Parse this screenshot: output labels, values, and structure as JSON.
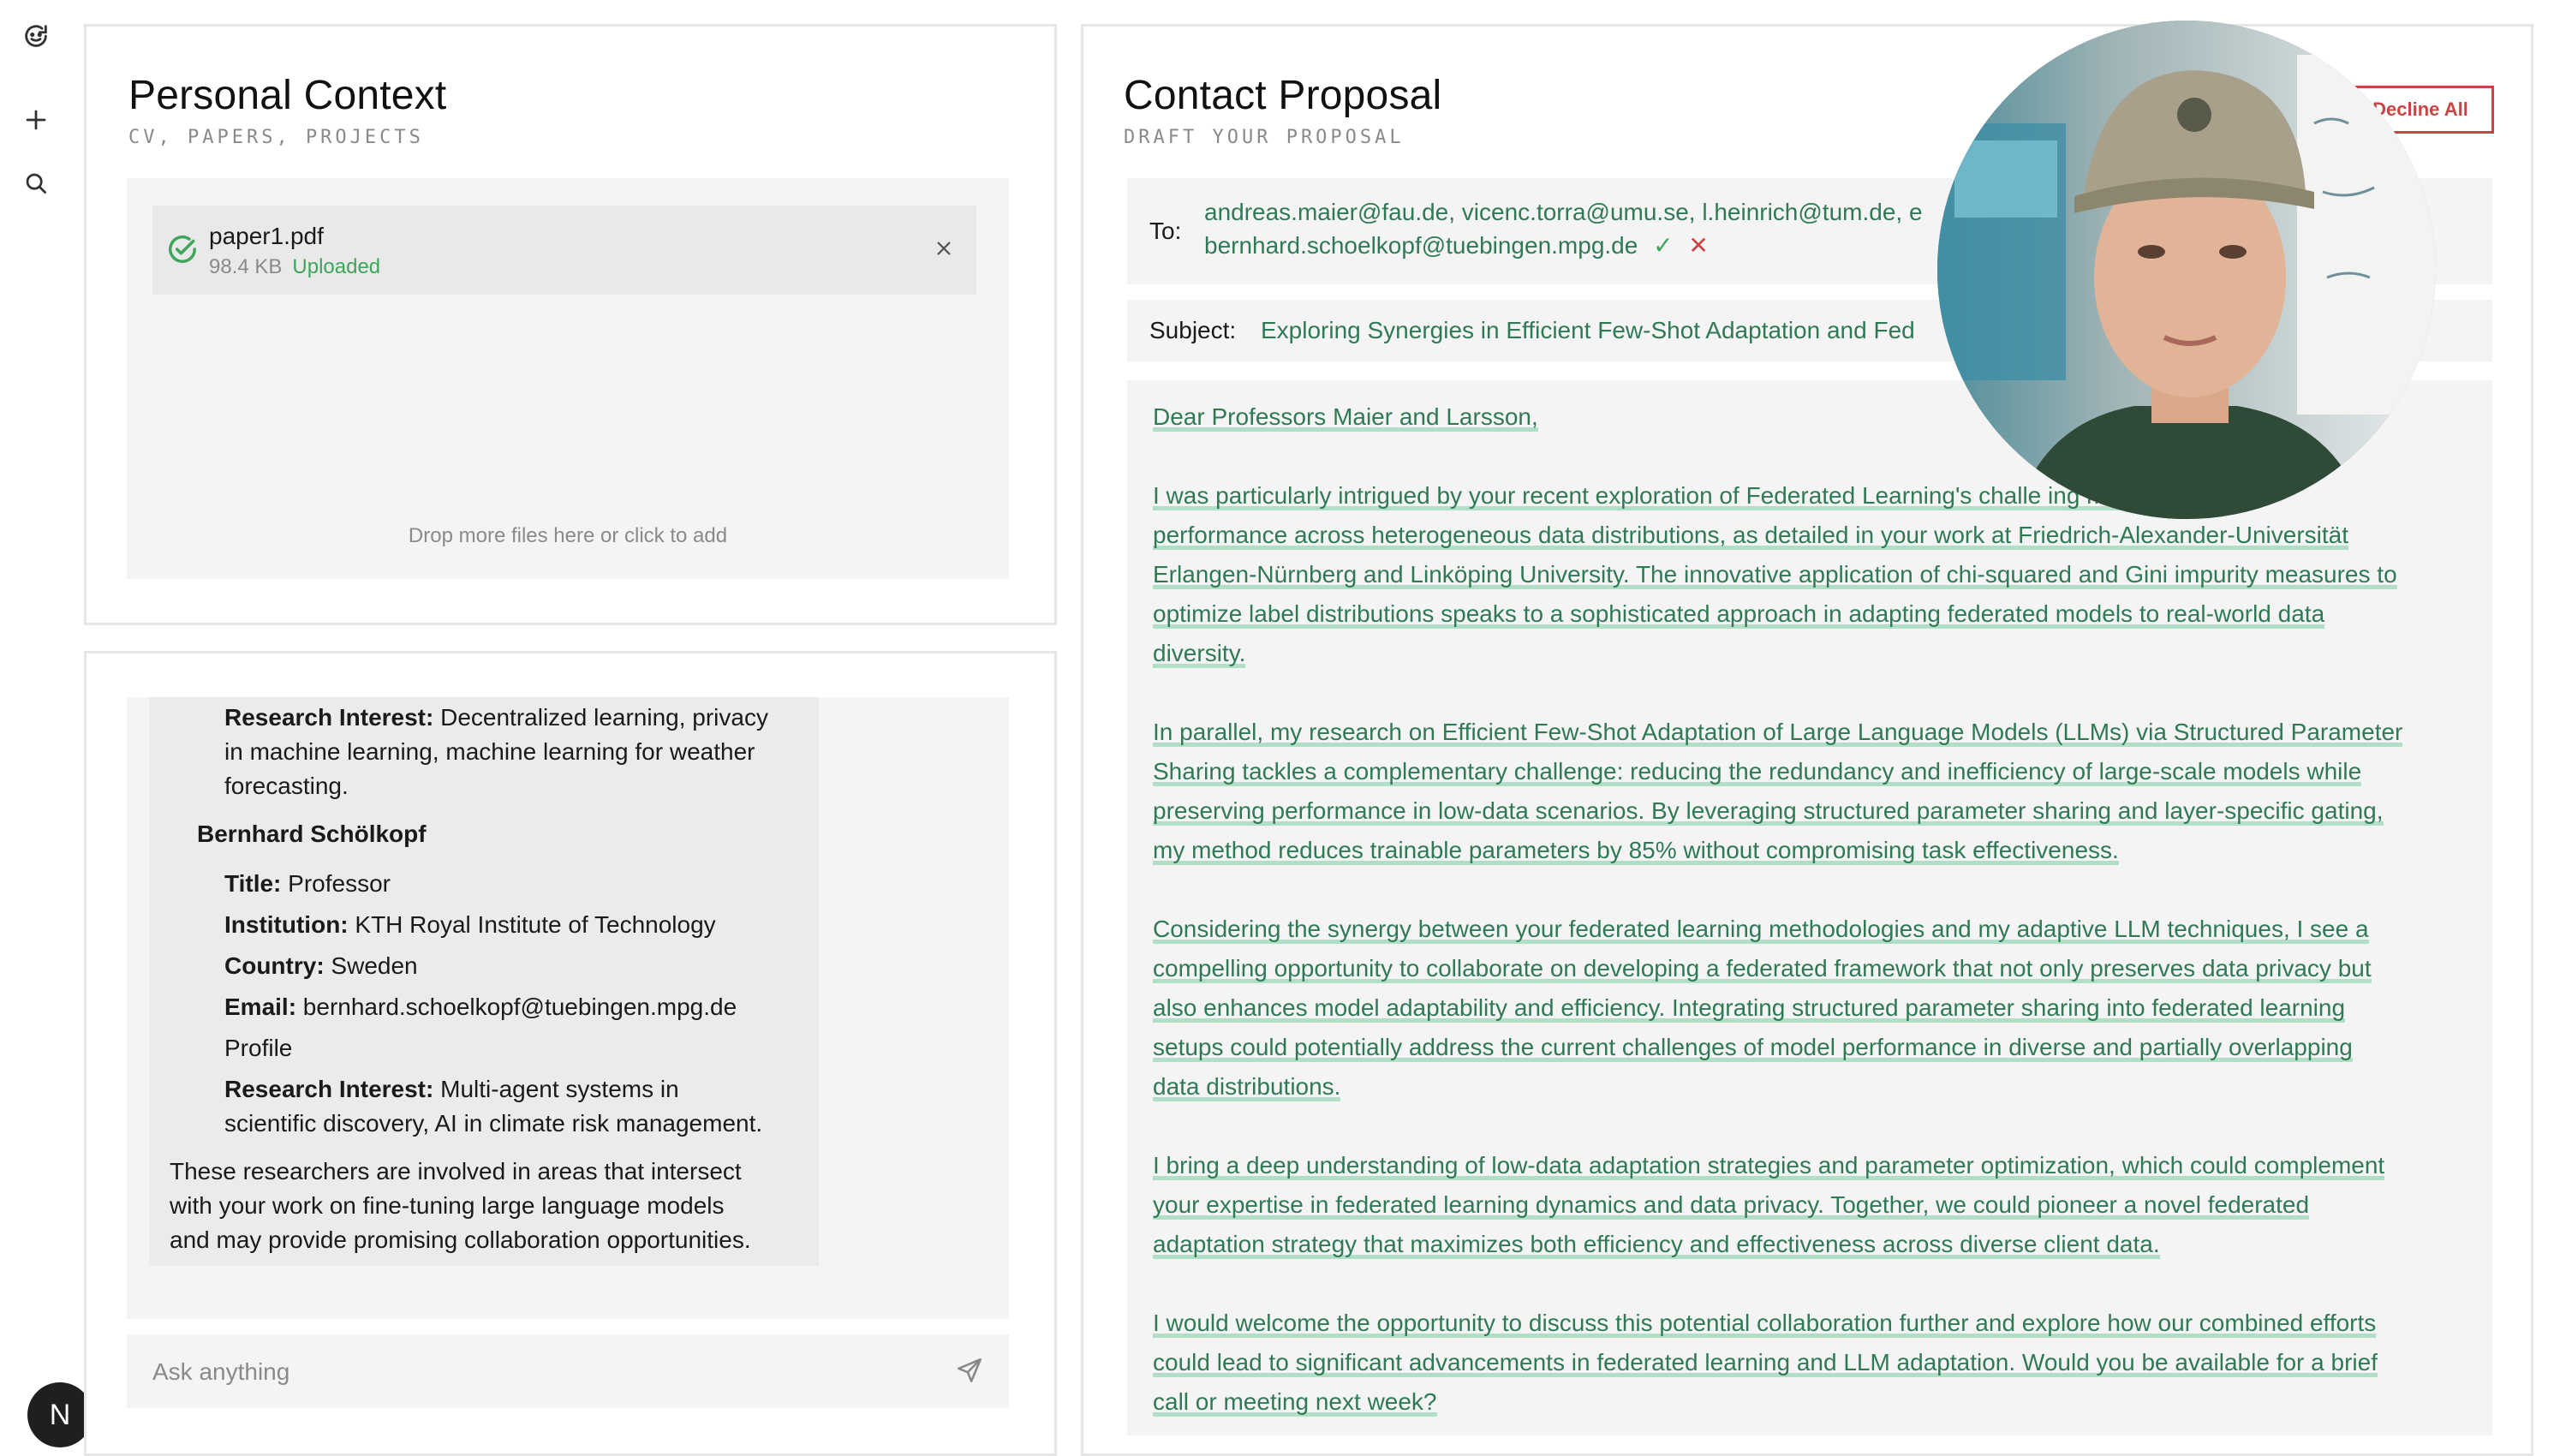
{
  "sidebar": {
    "icons": [
      "refresh-icon",
      "plus-icon",
      "search-icon"
    ],
    "avatar_letter": "N"
  },
  "personal_context": {
    "title": "Personal Context",
    "subtitle": "CV, PAPERS, PROJECTS",
    "file": {
      "name": "paper1.pdf",
      "size": "98.4 KB",
      "status": "Uploaded"
    },
    "drop_hint": "Drop more files here or click to add"
  },
  "chat": {
    "lines": [
      {
        "bold": "Research Interest:",
        "text": " Decentralized learning, privacy"
      },
      {
        "bold": "",
        "text": "in machine learning, machine learning for weather"
      },
      {
        "bold": "",
        "text": "forecasting."
      },
      {
        "bold": "Bernhard Schölkopf",
        "text": ""
      },
      {
        "bold": "Title:",
        "text": " Professor"
      },
      {
        "bold": "Institution:",
        "text": " KTH Royal Institute of Technology"
      },
      {
        "bold": "Country:",
        "text": " Sweden"
      },
      {
        "bold": "Email:",
        "text": " bernhard.schoelkopf@tuebingen.mpg.de"
      },
      {
        "bold": "",
        "text": "Profile"
      },
      {
        "bold": "Research Interest:",
        "text": " Multi-agent systems in"
      },
      {
        "bold": "",
        "text": "scientific discovery, AI in climate risk management."
      },
      {
        "bold": "",
        "text": "These researchers are involved in areas that intersect"
      },
      {
        "bold": "",
        "text": "with your work on fine-tuning large language models"
      },
      {
        "bold": "",
        "text": "and may provide promising collaboration opportunities."
      }
    ],
    "ask_placeholder": "Ask anything"
  },
  "proposal": {
    "title": "Contact Proposal",
    "subtitle": "DRAFT YOUR PROPOSAL",
    "decline_all": "Decline All",
    "to_label": "To:",
    "to_line1": "andreas.maier@fau.de, vicenc.torra@umu.se, l.heinrich@tum.de, e",
    "to_line2": "bernhard.schoelkopf@tuebingen.mpg.de",
    "subject_label": "Subject:",
    "subject_value": "Exploring Synergies in Efficient Few-Shot Adaptation and Fed",
    "body_lines": [
      "Dear Professors Maier and Larsson,",
      "",
      "I was particularly intrigued by your recent exploration of Federated Learning's challe          ing model",
      "performance across heterogeneous data distributions, as detailed in your work at Friedrich-Alexander-Universität",
      "Erlangen-Nürnberg and Linköping University. The innovative application of chi-squared and Gini impurity measures to",
      "optimize label distributions speaks to a sophisticated approach in adapting federated models to real-world data",
      "diversity.",
      "",
      "In parallel, my research on Efficient Few-Shot Adaptation of Large Language Models (LLMs) via Structured Parameter",
      "Sharing tackles a complementary challenge: reducing the redundancy and inefficiency of large-scale models while",
      "preserving performance in low-data scenarios. By leveraging structured parameter sharing and layer-specific gating,",
      "my method reduces trainable parameters by 85% without compromising task effectiveness.",
      "",
      "Considering the synergy between your federated learning methodologies and my adaptive LLM techniques, I see a",
      "compelling opportunity to collaborate on developing a federated framework that not only preserves data privacy but",
      "also enhances model adaptability and efficiency. Integrating structured parameter sharing into federated learning",
      "setups could potentially address the current challenges of model performance in diverse and partially overlapping",
      "data distributions.",
      "",
      "I bring a deep understanding of low-data adaptation strategies and parameter optimization, which could complement",
      "your expertise in federated learning dynamics and data privacy. Together, we could pioneer a novel federated",
      "adaptation strategy that maximizes both efficiency and effectiveness across diverse client data.",
      "",
      "I would welcome the opportunity to discuss this potential collaboration further and explore how our combined efforts",
      "could lead to significant advancements in federated learning and LLM adaptation. Would you be available for a brief",
      "call or meeting next week?"
    ]
  },
  "colors": {
    "accent_green": "#2f7a55",
    "highlight": "#78cda0",
    "decline_red": "#c94545"
  }
}
